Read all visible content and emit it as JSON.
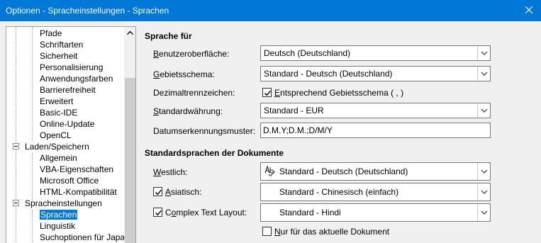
{
  "window": {
    "title": "Optionen - Spracheinstellungen - Sprachen"
  },
  "tree": {
    "items": [
      {
        "label": "Pfade",
        "level": "child"
      },
      {
        "label": "Schriftarten",
        "level": "child"
      },
      {
        "label": "Sicherheit",
        "level": "child"
      },
      {
        "label": "Personalisierung",
        "level": "child"
      },
      {
        "label": "Anwendungsfarben",
        "level": "child"
      },
      {
        "label": "Barrierefreiheit",
        "level": "child"
      },
      {
        "label": "Erweitert",
        "level": "child"
      },
      {
        "label": "Basic-IDE",
        "level": "child"
      },
      {
        "label": "Online-Update",
        "level": "child"
      },
      {
        "label": "OpenCL",
        "level": "child"
      },
      {
        "label": "Laden/Speichern",
        "level": "parent"
      },
      {
        "label": "Allgemein",
        "level": "child"
      },
      {
        "label": "VBA-Eigenschaften",
        "level": "child"
      },
      {
        "label": "Microsoft Office",
        "level": "child"
      },
      {
        "label": "HTML-Kompatibilität",
        "level": "child"
      },
      {
        "label": "Spracheinstellungen",
        "level": "parent"
      },
      {
        "label": "Sprachen",
        "level": "child",
        "selected": true
      },
      {
        "label": "Linguistik",
        "level": "child"
      },
      {
        "label": "Suchoptionen für Japa",
        "level": "child"
      }
    ]
  },
  "sprache_fuer": {
    "title": "Sprache für",
    "benutzeroberflaeche": {
      "label_u": "B",
      "label_rest": "enutzeroberfläche:",
      "value": "Deutsch (Deutschland)"
    },
    "gebietsschema": {
      "label_u": "G",
      "label_rest": "ebietsschema:",
      "value": "Standard - Deutsch (Deutschland)"
    },
    "dezimal": {
      "label": "Dezimaltrennzeichen:",
      "checkbox_u": "E",
      "checkbox_rest": "ntsprechend Gebietsschema ( , )",
      "checked": true
    },
    "waehrung": {
      "label_u": "S",
      "label_rest": "tandardwährung:",
      "value": "Standard - EUR"
    },
    "datum": {
      "label": "Datumserkennungsmuster:",
      "value": "D.M.Y;D.M.;D/M/Y"
    }
  },
  "standardsprachen": {
    "title": "Standardsprachen der Dokumente",
    "westlich": {
      "label_u": "W",
      "label_rest": "estlich:",
      "value": "Standard - Deutsch (Deutschland)"
    },
    "asiatisch": {
      "label_u": "A",
      "label_rest": "siatisch:",
      "value": "Standard - Chinesisch (einfach)",
      "checked": true
    },
    "ctl": {
      "label_pre": "C",
      "label_u": "o",
      "label_rest": "mplex Text Layout:",
      "value": "Standard - Hindi",
      "checked": true
    },
    "nur_dokument": {
      "label_u": "N",
      "label_rest": "ur für das aktuelle Dokument",
      "checked": false
    }
  },
  "icons": {
    "close": "close-icon",
    "spellcheck": "spellcheck-icon",
    "dropdown": "chevron-down-icon"
  },
  "colors": {
    "titlebar": "#0078d7",
    "selection": "#0078d7"
  }
}
